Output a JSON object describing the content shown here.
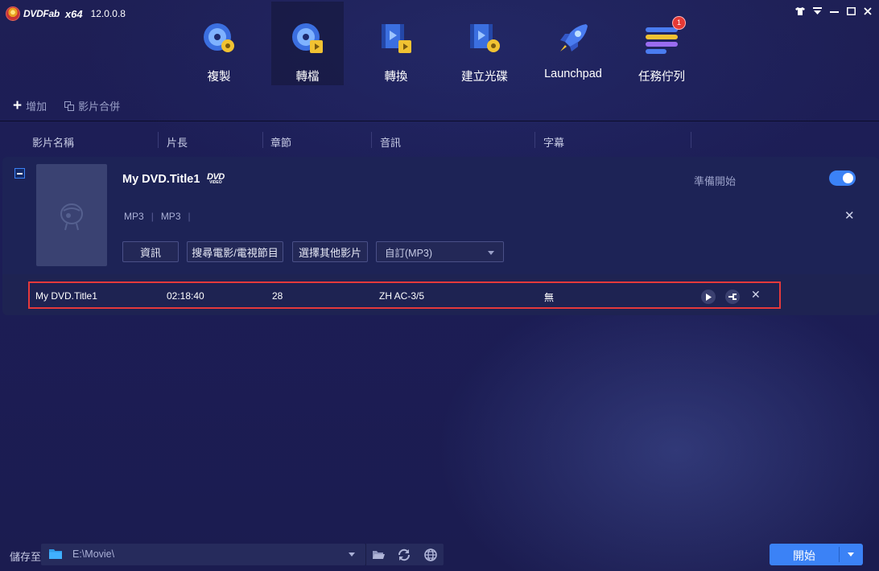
{
  "app": {
    "logo_text": "DVDFab",
    "arch": "x64",
    "version": "12.0.0.8"
  },
  "window_controls": [
    "skin-icon",
    "menu-icon",
    "minimize-icon",
    "maximize-icon",
    "close-icon"
  ],
  "nav": {
    "items": [
      {
        "label": "複製",
        "icon": "copy-disc-icon"
      },
      {
        "label": "轉檔",
        "icon": "convert-disc-icon",
        "active": true
      },
      {
        "label": "轉換",
        "icon": "converter-icon"
      },
      {
        "label": "建立光碟",
        "icon": "creator-icon"
      },
      {
        "label": "Launchpad",
        "icon": "rocket-icon"
      },
      {
        "label": "任務佇列",
        "icon": "task-queue-icon",
        "badge": "1"
      }
    ]
  },
  "toolbar": {
    "add_label": "增加",
    "merge_label": "影片合併"
  },
  "columns": [
    "影片名稱",
    "片長",
    "章節",
    "音訊",
    "字幕"
  ],
  "card": {
    "title": "My DVD.Title1",
    "source_badge": "DVD",
    "source_badge_sub": "VIDEO",
    "status": "準備開始",
    "toggle_on": true,
    "tags": [
      "MP3",
      "MP3"
    ],
    "buttons": {
      "info": "資訊",
      "search_movie": "搜尋電影/電視節目",
      "choose_other": "選擇其他影片"
    },
    "profile_select": "自訂(MP3)",
    "title_row": {
      "name": "My DVD.Title1",
      "duration": "02:18:40",
      "chapters": "28",
      "audio": "ZH  AC-3/5",
      "subtitle": "無"
    }
  },
  "bottom": {
    "save_to_label": "儲存至",
    "path": "E:\\Movie\\",
    "start_label": "開始"
  },
  "colors": {
    "accent": "#3b82f6",
    "highlight": "#e5393b",
    "background": "#1e1f55"
  }
}
